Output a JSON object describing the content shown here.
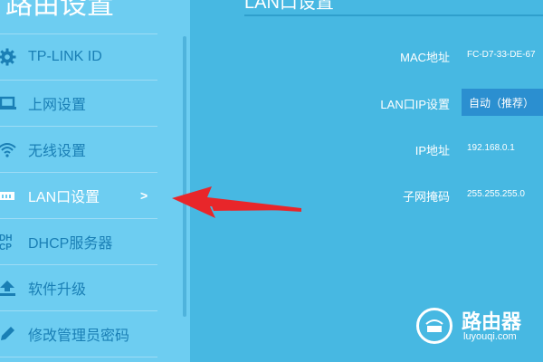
{
  "sidebar": {
    "title": "路由设置",
    "items": [
      {
        "label": "TP-LINK ID",
        "icon": "gear-icon"
      },
      {
        "label": "上网设置",
        "icon": "laptop-icon"
      },
      {
        "label": "无线设置",
        "icon": "wifi-icon"
      },
      {
        "label": "LAN口设置",
        "icon": "router-icon",
        "chevron": ">"
      },
      {
        "label": "DHCP服务器",
        "icon": "dhcp-icon"
      },
      {
        "label": "软件升级",
        "icon": "upload-icon"
      },
      {
        "label": "修改管理员密码",
        "icon": "pencil-icon"
      }
    ],
    "active_item": "LAN口设置",
    "dhcp_icon_text": "DH\nCP"
  },
  "main": {
    "title": "LAN口设置",
    "mac_label": "MAC地址",
    "mac_value": "FC-D7-33-DE-67",
    "lan_ip_label": "LAN口IP设置",
    "lan_ip_value": "自动（推荐）",
    "ip_label": "IP地址",
    "ip_value": "192.168.0.1",
    "mask_label": "子网掩码",
    "mask_value": "255.255.255.0"
  },
  "watermark": {
    "name": "路由器",
    "url": "luyouqi.com"
  },
  "colors": {
    "sidebar_bg": "#6dcdf1",
    "main_bg": "#47b8e2",
    "menu_text": "#1a7fb5",
    "select_bg": "#2b8fd0",
    "arrow": "#e8262a"
  }
}
